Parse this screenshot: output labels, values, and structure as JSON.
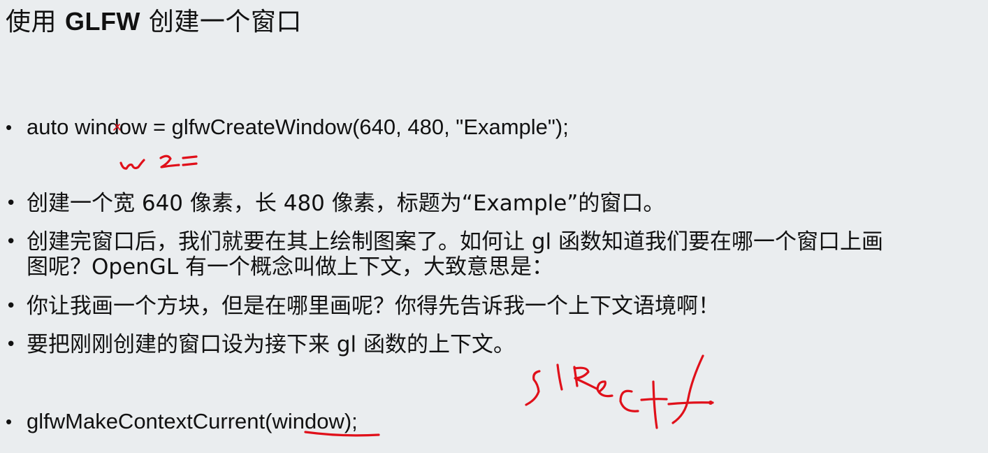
{
  "title": {
    "prefix": "使用 ",
    "bold": "GLFW",
    "suffix": " 创建一个窗口"
  },
  "bullets": [
    {
      "text": "auto window = glfwCreateWindow(640, 480, \"Example\");"
    },
    {
      "text": "创建一个宽 640 像素，长 480 像素，标题为“Example”的窗口。"
    },
    {
      "line1": "创建完窗口后，我们就要在其上绘制图案了。如何让 gl 函数知道我们要在哪一个窗口上画",
      "line2": "图呢？OpenGL 有一个概念叫做上下文，大致意思是："
    },
    {
      "text": "你让我画一个方块，但是在哪里画呢？你得先告诉我一个上下文语境啊！"
    },
    {
      "text": "要把刚刚创建的窗口设为接下来 gl 函数的上下文。"
    },
    {
      "prefix": "glfwMakeContextCurrent(",
      "underlined": "window",
      "suffix": ");"
    }
  ],
  "bullet_glyph": "•",
  "annotation_color": "#e0101a"
}
